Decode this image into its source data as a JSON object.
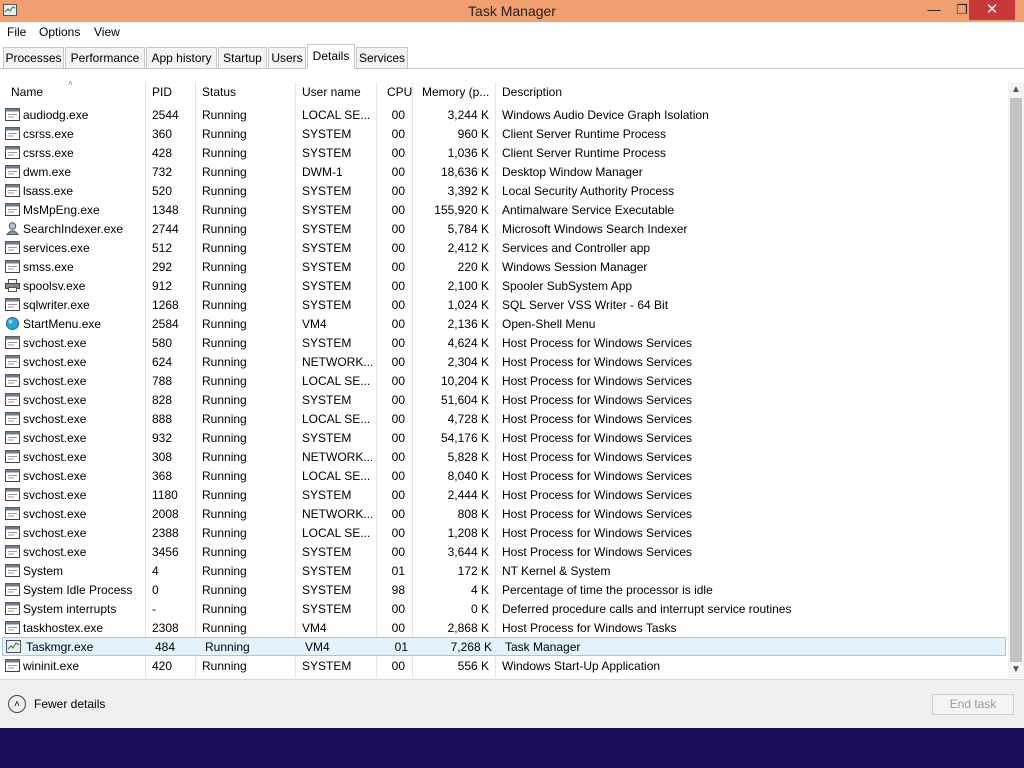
{
  "window": {
    "title": "Task Manager",
    "minimize": "—",
    "maximize": "❐",
    "close": "✕"
  },
  "menu": [
    "File",
    "Options",
    "View"
  ],
  "tabs": [
    "Processes",
    "Performance",
    "App history",
    "Startup",
    "Users",
    "Details",
    "Services"
  ],
  "active_tab": "Details",
  "columns": [
    "Name",
    "PID",
    "Status",
    "User name",
    "CPU",
    "Memory (p...",
    "Description"
  ],
  "sort_indicator": "˄",
  "rows": [
    {
      "icon": "process-icon",
      "name": "audiodg.exe",
      "pid": "2544",
      "status": "Running",
      "user": "LOCAL SE...",
      "cpu": "00",
      "mem": "3,244 K",
      "desc": "Windows Audio Device Graph Isolation"
    },
    {
      "icon": "process-icon",
      "name": "csrss.exe",
      "pid": "360",
      "status": "Running",
      "user": "SYSTEM",
      "cpu": "00",
      "mem": "960 K",
      "desc": "Client Server Runtime Process"
    },
    {
      "icon": "process-icon",
      "name": "csrss.exe",
      "pid": "428",
      "status": "Running",
      "user": "SYSTEM",
      "cpu": "00",
      "mem": "1,036 K",
      "desc": "Client Server Runtime Process"
    },
    {
      "icon": "process-icon",
      "name": "dwm.exe",
      "pid": "732",
      "status": "Running",
      "user": "DWM-1",
      "cpu": "00",
      "mem": "18,636 K",
      "desc": "Desktop Window Manager"
    },
    {
      "icon": "process-icon",
      "name": "lsass.exe",
      "pid": "520",
      "status": "Running",
      "user": "SYSTEM",
      "cpu": "00",
      "mem": "3,392 K",
      "desc": "Local Security Authority Process"
    },
    {
      "icon": "process-icon",
      "name": "MsMpEng.exe",
      "pid": "1348",
      "status": "Running",
      "user": "SYSTEM",
      "cpu": "00",
      "mem": "155,920 K",
      "desc": "Antimalware Service Executable"
    },
    {
      "icon": "search-indexer-icon",
      "name": "SearchIndexer.exe",
      "pid": "2744",
      "status": "Running",
      "user": "SYSTEM",
      "cpu": "00",
      "mem": "5,784 K",
      "desc": "Microsoft Windows Search Indexer"
    },
    {
      "icon": "process-icon",
      "name": "services.exe",
      "pid": "512",
      "status": "Running",
      "user": "SYSTEM",
      "cpu": "00",
      "mem": "2,412 K",
      "desc": "Services and Controller app"
    },
    {
      "icon": "process-icon",
      "name": "smss.exe",
      "pid": "292",
      "status": "Running",
      "user": "SYSTEM",
      "cpu": "00",
      "mem": "220 K",
      "desc": "Windows Session Manager"
    },
    {
      "icon": "printer-icon",
      "name": "spoolsv.exe",
      "pid": "912",
      "status": "Running",
      "user": "SYSTEM",
      "cpu": "00",
      "mem": "2,100 K",
      "desc": "Spooler SubSystem App"
    },
    {
      "icon": "process-icon",
      "name": "sqlwriter.exe",
      "pid": "1268",
      "status": "Running",
      "user": "SYSTEM",
      "cpu": "00",
      "mem": "1,024 K",
      "desc": "SQL Server VSS Writer - 64 Bit"
    },
    {
      "icon": "shell-icon",
      "name": "StartMenu.exe",
      "pid": "2584",
      "status": "Running",
      "user": "VM4",
      "cpu": "00",
      "mem": "2,136 K",
      "desc": "Open-Shell Menu"
    },
    {
      "icon": "process-icon",
      "name": "svchost.exe",
      "pid": "580",
      "status": "Running",
      "user": "SYSTEM",
      "cpu": "00",
      "mem": "4,624 K",
      "desc": "Host Process for Windows Services"
    },
    {
      "icon": "process-icon",
      "name": "svchost.exe",
      "pid": "624",
      "status": "Running",
      "user": "NETWORK...",
      "cpu": "00",
      "mem": "2,304 K",
      "desc": "Host Process for Windows Services"
    },
    {
      "icon": "process-icon",
      "name": "svchost.exe",
      "pid": "788",
      "status": "Running",
      "user": "LOCAL SE...",
      "cpu": "00",
      "mem": "10,204 K",
      "desc": "Host Process for Windows Services"
    },
    {
      "icon": "process-icon",
      "name": "svchost.exe",
      "pid": "828",
      "status": "Running",
      "user": "SYSTEM",
      "cpu": "00",
      "mem": "51,604 K",
      "desc": "Host Process for Windows Services"
    },
    {
      "icon": "process-icon",
      "name": "svchost.exe",
      "pid": "888",
      "status": "Running",
      "user": "LOCAL SE...",
      "cpu": "00",
      "mem": "4,728 K",
      "desc": "Host Process for Windows Services"
    },
    {
      "icon": "process-icon",
      "name": "svchost.exe",
      "pid": "932",
      "status": "Running",
      "user": "SYSTEM",
      "cpu": "00",
      "mem": "54,176 K",
      "desc": "Host Process for Windows Services"
    },
    {
      "icon": "process-icon",
      "name": "svchost.exe",
      "pid": "308",
      "status": "Running",
      "user": "NETWORK...",
      "cpu": "00",
      "mem": "5,828 K",
      "desc": "Host Process for Windows Services"
    },
    {
      "icon": "process-icon",
      "name": "svchost.exe",
      "pid": "368",
      "status": "Running",
      "user": "LOCAL SE...",
      "cpu": "00",
      "mem": "8,040 K",
      "desc": "Host Process for Windows Services"
    },
    {
      "icon": "process-icon",
      "name": "svchost.exe",
      "pid": "1180",
      "status": "Running",
      "user": "SYSTEM",
      "cpu": "00",
      "mem": "2,444 K",
      "desc": "Host Process for Windows Services"
    },
    {
      "icon": "process-icon",
      "name": "svchost.exe",
      "pid": "2008",
      "status": "Running",
      "user": "NETWORK...",
      "cpu": "00",
      "mem": "808 K",
      "desc": "Host Process for Windows Services"
    },
    {
      "icon": "process-icon",
      "name": "svchost.exe",
      "pid": "2388",
      "status": "Running",
      "user": "LOCAL SE...",
      "cpu": "00",
      "mem": "1,208 K",
      "desc": "Host Process for Windows Services"
    },
    {
      "icon": "process-icon",
      "name": "svchost.exe",
      "pid": "3456",
      "status": "Running",
      "user": "SYSTEM",
      "cpu": "00",
      "mem": "3,644 K",
      "desc": "Host Process for Windows Services"
    },
    {
      "icon": "process-icon",
      "name": "System",
      "pid": "4",
      "status": "Running",
      "user": "SYSTEM",
      "cpu": "01",
      "mem": "172 K",
      "desc": "NT Kernel & System"
    },
    {
      "icon": "process-icon",
      "name": "System Idle Process",
      "pid": "0",
      "status": "Running",
      "user": "SYSTEM",
      "cpu": "98",
      "mem": "4 K",
      "desc": "Percentage of time the processor is idle"
    },
    {
      "icon": "process-icon",
      "name": "System interrupts",
      "pid": "-",
      "status": "Running",
      "user": "SYSTEM",
      "cpu": "00",
      "mem": "0 K",
      "desc": "Deferred procedure calls and interrupt service routines"
    },
    {
      "icon": "process-icon",
      "name": "taskhostex.exe",
      "pid": "2308",
      "status": "Running",
      "user": "VM4",
      "cpu": "00",
      "mem": "2,868 K",
      "desc": "Host Process for Windows Tasks"
    },
    {
      "icon": "taskmgr-icon",
      "name": "Taskmgr.exe",
      "pid": "484",
      "status": "Running",
      "user": "VM4",
      "cpu": "01",
      "mem": "7,268 K",
      "desc": "Task Manager",
      "selected": true
    },
    {
      "icon": "process-icon",
      "name": "wininit.exe",
      "pid": "420",
      "status": "Running",
      "user": "SYSTEM",
      "cpu": "00",
      "mem": "556 K",
      "desc": "Windows Start-Up Application"
    }
  ],
  "footer": {
    "fewer_details": "Fewer details",
    "fewer_icon": "˄",
    "end_task": "End task"
  },
  "scrollbar": {
    "up": "▲",
    "down": "▼"
  },
  "colors": {
    "titlebar": "#f0a070",
    "close": "#c7383b",
    "selection": "#e4f2fb",
    "desktop": "#1d0c5c"
  }
}
